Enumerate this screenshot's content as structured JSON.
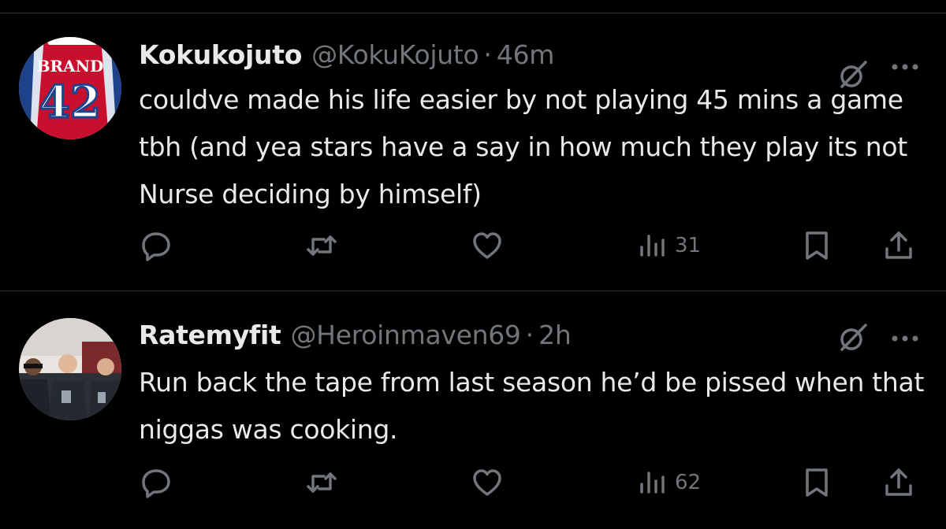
{
  "tweets": [
    {
      "display_name": "Kokukojuto",
      "handle": "@KokuKojuto",
      "separator": "·",
      "time": "46m",
      "text": "couldve made his life easier by not playing 45 mins a game tbh (and yea stars have a say in how much they play its not Nurse deciding by himself)",
      "avatar_jersey_name": "BRAND",
      "avatar_jersey_number": "42",
      "views": "31"
    },
    {
      "display_name": "Ratemyfit",
      "handle": "@Heroinmaven69",
      "separator": "·",
      "time": "2h",
      "text": "Run back the tape from last season he’d be pissed when that niggas was cooking.",
      "views": "62"
    }
  ],
  "icons": {
    "reply": "reply-icon",
    "retweet": "retweet-icon",
    "like": "heart-icon",
    "views": "views-chart-icon",
    "bookmark": "bookmark-icon",
    "share": "share-icon",
    "grok": "grok-icon",
    "more": "more-dots-icon"
  },
  "colors": {
    "background": "#000000",
    "text_primary": "#e7e9ea",
    "text_secondary": "#71767b",
    "divider": "#2f3336",
    "jersey_red": "#c8102e",
    "jersey_blue": "#1d428a"
  }
}
